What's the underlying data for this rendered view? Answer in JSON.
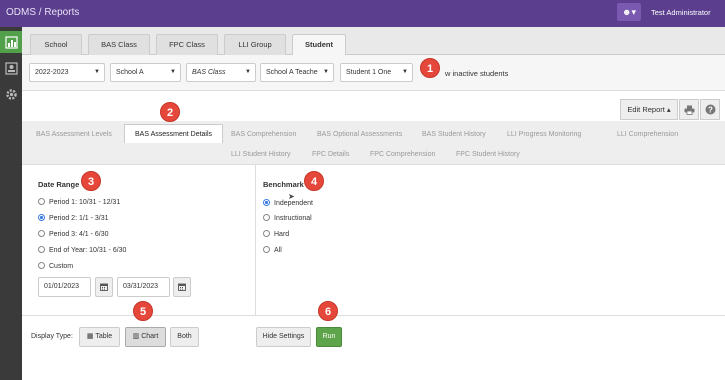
{
  "header": {
    "brand": "ODMS / Reports",
    "user_icon": "user-icon",
    "user_caret": "▾",
    "user_name": "Test Administrator"
  },
  "sidebar": {
    "items": [
      {
        "icon": "reports-chart-icon",
        "active": true
      },
      {
        "icon": "student-card-icon",
        "active": false
      },
      {
        "icon": "gear-icon",
        "active": false
      }
    ]
  },
  "tabs": [
    {
      "label": "School"
    },
    {
      "label": "BAS Class"
    },
    {
      "label": "FPC Class"
    },
    {
      "label": "LLI Group"
    },
    {
      "label": "Student",
      "active": true
    }
  ],
  "filters": {
    "year": "2022-2023",
    "school": "School A",
    "class": "BAS Class",
    "teacher": "School A Teache",
    "student": "Student 1 One",
    "inactive_label": "w inactive students"
  },
  "toolbar": {
    "edit_report": "Edit Report ▴",
    "print_icon": "print-icon",
    "help_icon": "help-icon"
  },
  "subtabs": {
    "row1": [
      "BAS Assessment Levels",
      "BAS Assessment Details",
      "BAS Comprehension",
      "BAS Optional Assessments",
      "BAS Student History",
      "LLI Progress Monitoring",
      "LLI Comprehension"
    ],
    "row2": [
      "LLI Student History",
      "FPC Details",
      "FPC Comprehension",
      "FPC Student History"
    ]
  },
  "date_range": {
    "title": "Date Range",
    "options": [
      "Period 1: 10/31 - 12/31",
      "Period 2: 1/1 - 3/31",
      "Period 3: 4/1 - 6/30",
      "End of Year: 10/31 - 6/30",
      "Custom"
    ],
    "selected_index": 1,
    "start_date": "01/01/2023",
    "end_date": "03/31/2023",
    "calendar_icon": "calendar-icon"
  },
  "benchmark": {
    "title": "Benchmark",
    "options": [
      "Independent",
      "Instructional",
      "Hard",
      "All"
    ],
    "selected_index": 0
  },
  "display": {
    "label": "Display Type:",
    "table": "Table",
    "chart": "Chart",
    "both": "Both",
    "hide_settings": "Hide Settings",
    "run": "Run"
  },
  "badges": [
    "1",
    "2",
    "3",
    "4",
    "5",
    "6"
  ],
  "colors": {
    "header": "#5b3f8e",
    "sidebar": "#3a3a3a",
    "active_icon": "#52a04a",
    "badge": "#e5483a",
    "run": "#5da44a"
  }
}
